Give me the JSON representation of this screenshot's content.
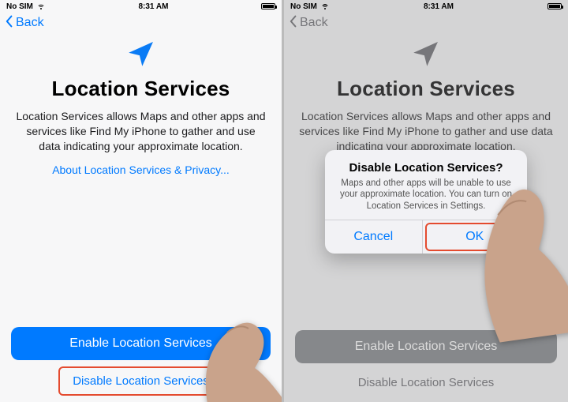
{
  "left": {
    "status": {
      "nosim": "No SIM",
      "time": "8:31 AM"
    },
    "nav": {
      "back": "Back"
    },
    "title": "Location Services",
    "body": "Location Services allows Maps and other apps and services like Find My iPhone to gather and use data indicating your approximate location.",
    "about": "About Location Services & Privacy...",
    "enable": "Enable Location Services",
    "disable": "Disable Location S",
    "disable_full": "Disable Location Services"
  },
  "right": {
    "status": {
      "nosim": "No SIM",
      "time": "8:31 AM"
    },
    "nav": {
      "back": "Back"
    },
    "title": "Location Services",
    "body": "Location Services allows Maps and other apps and services like Find My iPhone to gather and use data indicating your approximate location.",
    "enable": "Enable Location Services",
    "disable": "Disable Location Services",
    "alert": {
      "title": "Disable Location Services?",
      "text": "Maps and other apps will be unable to use your approximate location. You can turn on Location Services in Settings.",
      "cancel": "Cancel",
      "ok": "OK"
    }
  }
}
